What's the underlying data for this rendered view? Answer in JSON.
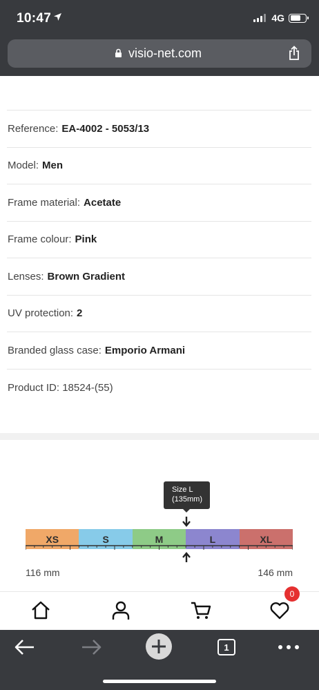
{
  "status_bar": {
    "time": "10:47",
    "network": "4G"
  },
  "browser": {
    "url": "visio-net.com",
    "tab_count": "1"
  },
  "specs": [
    {
      "label": "Reference:",
      "value": "EA-4002 - 5053/13"
    },
    {
      "label": "Model:",
      "value": "Men"
    },
    {
      "label": "Frame material:",
      "value": "Acetate"
    },
    {
      "label": "Frame colour:",
      "value": "Pink"
    },
    {
      "label": "Lenses:",
      "value": "Brown Gradient"
    },
    {
      "label": "UV protection:",
      "value": "2"
    },
    {
      "label": "Branded glass case:",
      "value": "Emporio Armani"
    },
    {
      "label": "Product ID: 18524-(55)",
      "value": ""
    }
  ],
  "size_chart": {
    "tooltip_line1": "Size L",
    "tooltip_line2": "(135mm)",
    "selected": "L",
    "sizes": [
      {
        "label": "XS",
        "color": "#f0a868"
      },
      {
        "label": "S",
        "color": "#87cbe9"
      },
      {
        "label": "M",
        "color": "#8ecb87"
      },
      {
        "label": "L",
        "color": "#8c86cf"
      },
      {
        "label": "XL",
        "color": "#cb706c"
      }
    ],
    "min_label": "116 mm",
    "max_label": "146 mm"
  },
  "site_nav": {
    "icons": [
      "home-icon",
      "account-icon",
      "cart-icon",
      "wishlist-icon"
    ],
    "wishlist_count": "0"
  },
  "browser_toolbar": {
    "icons": [
      "back-arrow-icon",
      "forward-arrow-icon",
      "new-tab-icon",
      "tabs-icon",
      "more-icon"
    ]
  }
}
